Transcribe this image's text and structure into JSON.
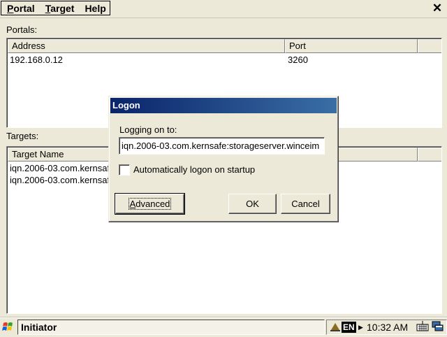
{
  "menu": {
    "items": [
      {
        "label": "Portal",
        "accel": "P",
        "rest": "ortal"
      },
      {
        "label": "Target",
        "accel": "T",
        "rest": "arget"
      },
      {
        "label": "Help"
      }
    ],
    "close_glyph": "✕"
  },
  "portals": {
    "label": "Portals:",
    "columns": [
      "Address",
      "Port"
    ],
    "rows": [
      {
        "address": "192.168.0.12",
        "port": "3260"
      }
    ]
  },
  "targets": {
    "label": "Targets:",
    "columns": [
      "Target Name"
    ],
    "rows": [
      {
        "name": "iqn.2006-03.com.kernsaf"
      },
      {
        "name": "iqn.2006-03.com.kernsaf"
      }
    ]
  },
  "logon_dialog": {
    "title": "Logon",
    "logging_on_label": "Logging on to:",
    "target_value": "iqn.2006-03.com.kernsafe:storageserver.winceim",
    "auto_logon_label": "Automatically logon on startup",
    "auto_logon_checked": false,
    "advanced_label": "Advanced",
    "advanced_accel": "A",
    "advanced_rest": "dvanced",
    "ok_label": "OK",
    "cancel_label": "Cancel"
  },
  "taskbar": {
    "start_icon": "windows-flag-icon",
    "task_label": "Initiator",
    "input_lang": "EN",
    "clock": "10:32 AM",
    "colors": {
      "titlebar_start": "#0a246a",
      "titlebar_end": "#3a6ea5",
      "face": "#ece9d8"
    }
  }
}
